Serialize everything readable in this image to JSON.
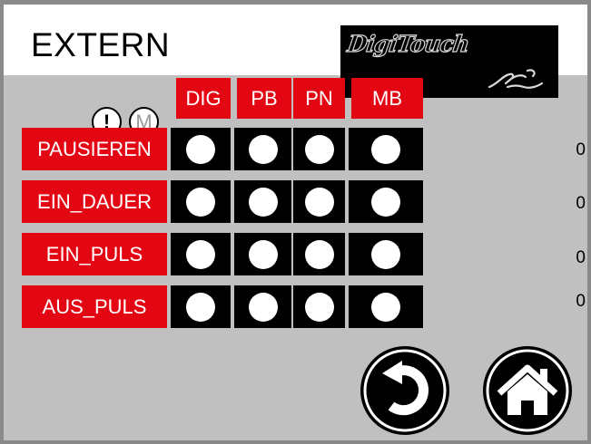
{
  "header": {
    "title": "EXTERN",
    "logo_text": "DigiTouch"
  },
  "columns": [
    "DIG",
    "PB",
    "PN",
    "MB"
  ],
  "badges": {
    "alert": "!",
    "manual": "M"
  },
  "rows": [
    {
      "label": "PAUSIEREN",
      "value": "0"
    },
    {
      "label": "EIN_DAUER",
      "value": "0"
    },
    {
      "label": "EIN_PULS",
      "value": "0"
    },
    {
      "label": "AUS_PULS",
      "value": "0"
    }
  ],
  "icons": {
    "back": "back-arrow-icon",
    "home": "home-icon"
  },
  "colors": {
    "accent": "#e30613",
    "background": "#c0c0c0",
    "cell": "#000000",
    "indicator": "#ffffff"
  }
}
